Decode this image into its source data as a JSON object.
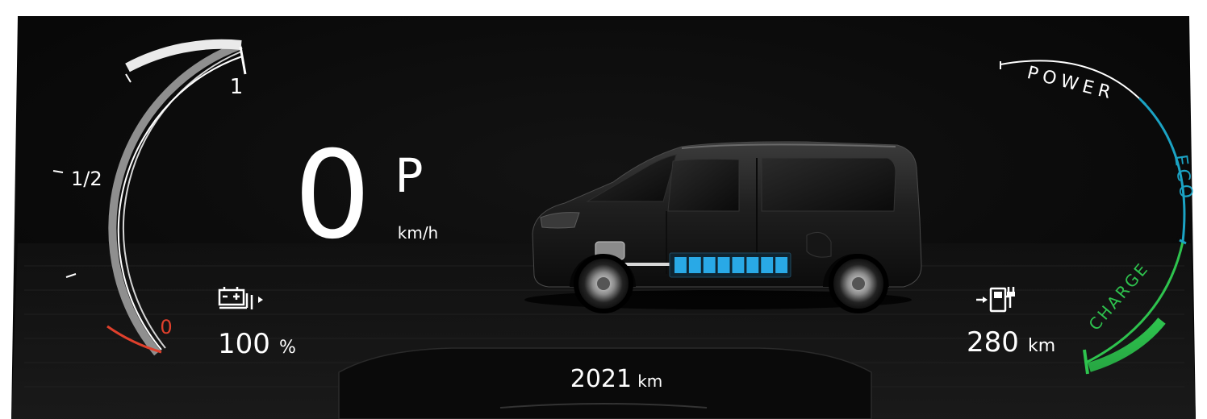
{
  "battery_gauge": {
    "label_full": "1",
    "label_half": "1/2",
    "label_empty": "0",
    "level": 1.0,
    "empty_color": "#e0402c"
  },
  "speed": {
    "value": "0",
    "unit": "km/h",
    "gear": "P"
  },
  "charge_status": {
    "icon": "battery-charge-icon",
    "value": "100",
    "unit": "%"
  },
  "vehicle": {
    "image": "electric-van-image",
    "battery_cells": 8,
    "battery_color": "#29a9e6"
  },
  "odometer": {
    "value": "2021",
    "unit": "km"
  },
  "range": {
    "icon": "range-plug-icon",
    "value": "280",
    "unit": "km"
  },
  "power_meter": {
    "zone_power": "POWER",
    "zone_eco": "ECO",
    "zone_charge": "CHARGE",
    "eco_color": "#1ba3c4",
    "charge_color": "#2ec34e"
  }
}
